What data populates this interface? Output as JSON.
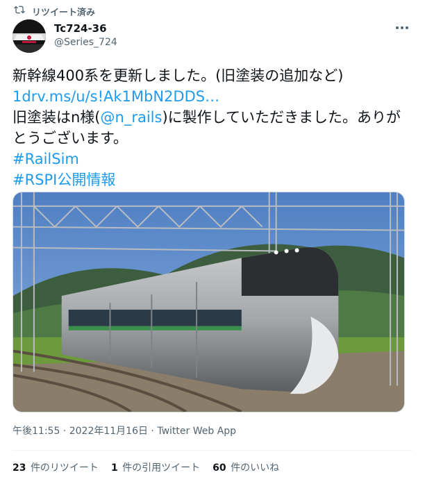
{
  "retweet": {
    "label": "リツイート済み"
  },
  "author": {
    "display_name": "Tc724-36",
    "handle": "@Series_724"
  },
  "tweet": {
    "line1": "新幹線400系を更新しました。(旧塗装の追加など)",
    "link": "1drv.ms/u/s!Ak1MbN2DDS…",
    "line3_pre": "旧塗装はn様(",
    "mention": "@n_rails",
    "line3_post": ")に製作していただきました。ありがとうございます。",
    "hashtag1": "#RailSim",
    "hashtag2": "#RSPI公開情報"
  },
  "meta": {
    "time": "午後11:55",
    "separator1": " · ",
    "date": "2022年11月16日",
    "separator2": " · ",
    "source": "Twitter Web App"
  },
  "stats": {
    "retweets_count": "23",
    "retweets_label": "件のリツイート",
    "quotes_count": "1",
    "quotes_label": "件の引用ツイート",
    "likes_count": "60",
    "likes_label": "件のいいね"
  },
  "colors": {
    "text": "#0f1419",
    "secondary": "#536471",
    "link": "#1d9bf0",
    "border": "#cfd9de",
    "divider": "#eff3f4"
  },
  "icons": {
    "retweet": "retweet-icon",
    "more": "more-icon"
  }
}
